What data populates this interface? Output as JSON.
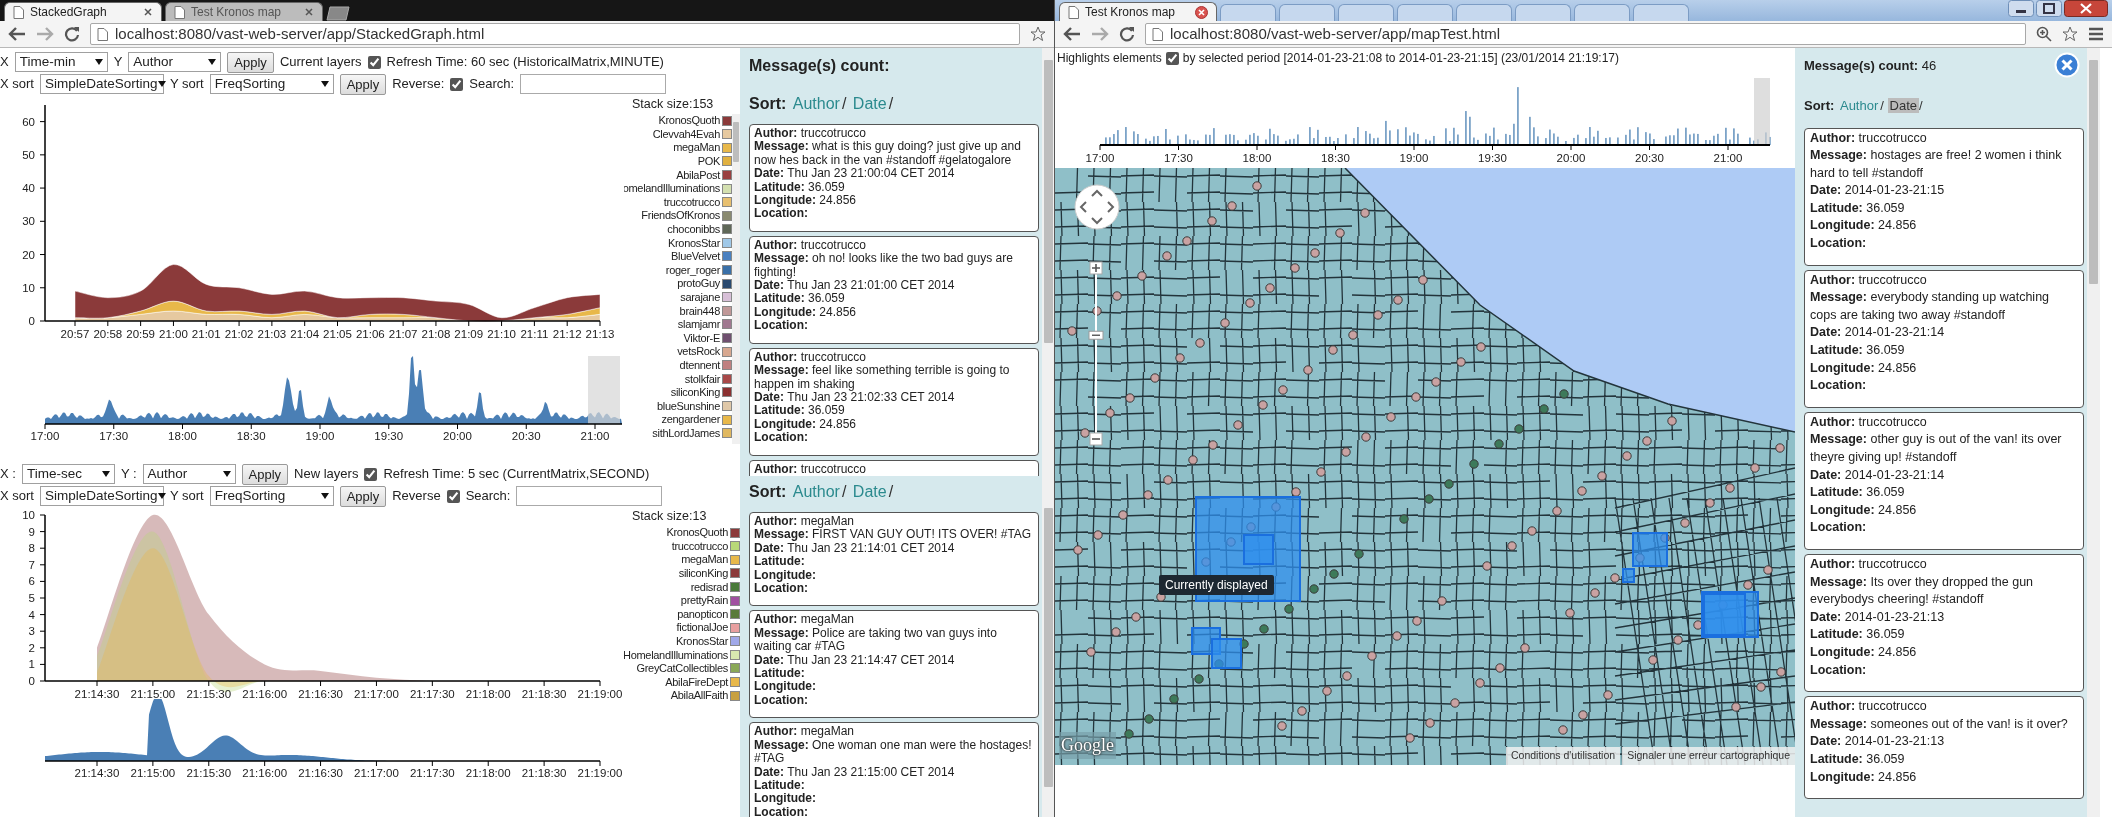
{
  "left_window": {
    "tabs": [
      {
        "title": "StackedGraph",
        "selected": true
      },
      {
        "title": "Test Kronos map",
        "selected": false
      }
    ],
    "address": "localhost:8080/vast-web-server/app/StackedGraph.html",
    "graphs": [
      {
        "controls": [
          [
            {
              "kind": "label",
              "text": "X"
            },
            {
              "kind": "select",
              "value": "Time-min"
            },
            {
              "kind": "label",
              "text": "Y"
            },
            {
              "kind": "select",
              "value": "Author"
            },
            {
              "kind": "button",
              "text": "Apply"
            },
            {
              "kind": "label",
              "text": "Current layers"
            },
            {
              "kind": "checkbox",
              "checked": true
            },
            {
              "kind": "label",
              "text": "Refresh Time: 60 sec (HistoricalMatrix,MINUTE)"
            }
          ],
          [
            {
              "kind": "label",
              "text": "X sort"
            },
            {
              "kind": "select",
              "value": "SimpleDateSorting"
            },
            {
              "kind": "label",
              "text": "Y sort"
            },
            {
              "kind": "select",
              "value": "FreqSorting"
            },
            {
              "kind": "button",
              "text": "Apply"
            },
            {
              "kind": "label",
              "text": "Reverse:"
            },
            {
              "kind": "checkbox",
              "checked": true
            },
            {
              "kind": "label",
              "text": "Search:"
            },
            {
              "kind": "input"
            }
          ]
        ],
        "stack_size": "Stack size:153",
        "legend": [
          {
            "name": "KronosQuoth",
            "color": "#8b3a3a"
          },
          {
            "name": "Clevvah4Evah",
            "color": "#e6c9a0"
          },
          {
            "name": "megaMan",
            "color": "#e8b84a"
          },
          {
            "name": "POK",
            "color": "#e0b040"
          },
          {
            "name": "AbilaPost",
            "color": "#9a4040"
          },
          {
            "name": "omelandIlluminations",
            "color": "#d4e0b0"
          },
          {
            "name": "truccotrucco",
            "color": "#e8c070"
          },
          {
            "name": "FriendsOfKronos",
            "color": "#8a8a70"
          },
          {
            "name": "choconibbs",
            "color": "#606858"
          },
          {
            "name": "KronosStar",
            "color": "#a0c8e8"
          },
          {
            "name": "BlueVelvet",
            "color": "#4a80c0"
          },
          {
            "name": "roger_roger",
            "color": "#3a70a8"
          },
          {
            "name": "protoGuy",
            "color": "#2a4a70"
          },
          {
            "name": "sarajane",
            "color": "#d8c0d8"
          },
          {
            "name": "brain448",
            "color": "#c09898"
          },
          {
            "name": "slamjamr",
            "color": "#a07890"
          },
          {
            "name": "Viktor-E",
            "color": "#705070"
          },
          {
            "name": "vetsRock",
            "color": "#d8a890"
          },
          {
            "name": "dtennent",
            "color": "#c08080"
          },
          {
            "name": "stolkfair",
            "color": "#a84848"
          },
          {
            "name": "siliconKing",
            "color": "#8b3030"
          },
          {
            "name": "blueSunshine",
            "color": "#e0c8a8"
          },
          {
            "name": "zengardener",
            "color": "#e8b84a"
          },
          {
            "name": "sithLordJames",
            "color": "#e0b860"
          }
        ],
        "chart_data": {
          "type": "area",
          "stacked": true,
          "ylim": [
            0,
            65
          ],
          "yticks": [
            0,
            10,
            20,
            30,
            40,
            50,
            60
          ],
          "categories": [
            "20:57",
            "20:58",
            "20:59",
            "21:00",
            "21:01",
            "21:02",
            "21:03",
            "21:04",
            "21:05",
            "21:06",
            "21:07",
            "21:08",
            "21:09",
            "21:10",
            "21:11",
            "21:12",
            "21:13"
          ],
          "series": [
            {
              "color": "#e6c9a0",
              "values": [
                1,
                1,
                2,
                3,
                2,
                2,
                1,
                2,
                1,
                1,
                1,
                1,
                0,
                0,
                1,
                1,
                2
              ]
            },
            {
              "color": "#e8b84a",
              "values": [
                0,
                0,
                1,
                3,
                1,
                1,
                1,
                1,
                0,
                1,
                1,
                0,
                0,
                0,
                0,
                1,
                2
              ]
            },
            {
              "color": "#8b3a3a",
              "values": [
                8,
                6,
                6,
                11,
                8,
                7,
                6,
                6,
                6,
                5,
                5,
                5,
                5,
                1,
                3,
                5,
                4
              ]
            }
          ]
        },
        "overview": {
          "ticks": [
            "17:00",
            "17:30",
            "18:00",
            "18:30",
            "19:00",
            "19:30",
            "20:00",
            "20:30",
            "21:00"
          ],
          "brush": true
        }
      },
      {
        "controls": [
          [
            {
              "kind": "label",
              "text": "X :"
            },
            {
              "kind": "select",
              "value": "Time-sec"
            },
            {
              "kind": "label",
              "text": "Y :"
            },
            {
              "kind": "select",
              "value": "Author"
            },
            {
              "kind": "button",
              "text": "Apply"
            },
            {
              "kind": "label",
              "text": "New layers"
            },
            {
              "kind": "checkbox",
              "checked": true
            },
            {
              "kind": "label",
              "text": "Refresh Time: 5 sec (CurrentMatrix,SECOND)"
            }
          ],
          [
            {
              "kind": "label",
              "text": "X sort"
            },
            {
              "kind": "select",
              "value": "SimpleDateSorting"
            },
            {
              "kind": "label",
              "text": "Y sort"
            },
            {
              "kind": "select",
              "value": "FreqSorting"
            },
            {
              "kind": "button",
              "text": "Apply"
            },
            {
              "kind": "label",
              "text": "Reverse"
            },
            {
              "kind": "checkbox",
              "checked": true
            },
            {
              "kind": "label",
              "text": "Search:"
            },
            {
              "kind": "input"
            }
          ]
        ],
        "stack_size": "Stack size:13",
        "legend": [
          {
            "name": "KronosQuoth",
            "color": "#8b3a3a"
          },
          {
            "name": "truccotrucco",
            "color": "#b8d878"
          },
          {
            "name": "megaMan",
            "color": "#e8b84a"
          },
          {
            "name": "siliconKing",
            "color": "#8b3a3a"
          },
          {
            "name": "redisrad",
            "color": "#4a7a3a"
          },
          {
            "name": "prettyRain",
            "color": "#a050a0"
          },
          {
            "name": "panopticon",
            "color": "#5a7a3a"
          },
          {
            "name": "fictionalJoe",
            "color": "#e8a0a0"
          },
          {
            "name": "KronosStar",
            "color": "#a0a8e8"
          },
          {
            "name": "HomelandIlluminations",
            "color": "#d8e8b0"
          },
          {
            "name": "GreyCatCollectibles",
            "color": "#8aa858"
          },
          {
            "name": "AbilaFireDept",
            "color": "#e8b84a"
          },
          {
            "name": "AbilaAllFaith",
            "color": "#c8a040"
          }
        ],
        "chart_data": {
          "type": "area",
          "stacked": false,
          "ylim": [
            0,
            10
          ],
          "yticks": [
            0,
            1,
            2,
            3,
            4,
            5,
            6,
            7,
            8,
            9,
            10
          ],
          "categories": [
            "21:14:30",
            "21:15:00",
            "21:15:30",
            "21:16:00",
            "21:16:30",
            "21:17:00",
            "21:17:30",
            "21:18:00",
            "21:18:30",
            "21:19:00"
          ],
          "series": [
            {
              "color": "#8b3a3a",
              "values": [
                2,
                10,
                4,
                1,
                0.6,
                0.2,
                0,
                0,
                0,
                0
              ]
            },
            {
              "color": "#b8d878",
              "values": [
                1.5,
                9,
                0,
                0,
                0,
                0,
                0,
                0,
                0,
                0
              ]
            },
            {
              "color": "#e8b84a",
              "values": [
                0.5,
                8,
                0.3,
                0,
                0,
                0,
                0,
                0,
                0,
                0
              ]
            }
          ]
        },
        "overview": {
          "ticks": [
            "21:14:30",
            "21:15:00",
            "21:15:30",
            "21:16:00",
            "21:16:30",
            "21:17:00",
            "21:17:30",
            "21:18:00",
            "21:18:30",
            "21:19:00"
          ]
        }
      }
    ],
    "messages_panel": {
      "sections": [
        {
          "count": {
            "label": "Message(s) count:"
          },
          "sort": {
            "label": "Sort:",
            "options": [
              {
                "label": "Author",
                "separator": "/",
                "selected": false
              },
              {
                "label": "Date",
                "separator": "/",
                "selected": false
              }
            ]
          },
          "messages": [
            {
              "fields": [
                {
                  "label": "Author:",
                  "value": "truccotrucco"
                },
                {
                  "label": "Message:",
                  "value": "what is this guy doing? just give up and now hes back in the van #standoff #gelatogalore"
                },
                {
                  "label": "Date:",
                  "value": "Thu Jan 23 21:00:04 CET 2014"
                },
                {
                  "label": "Latitude:",
                  "value": "36.059"
                },
                {
                  "label": "Longitude:",
                  "value": "24.856"
                },
                {
                  "label": "Location:"
                }
              ]
            },
            {
              "fields": [
                {
                  "label": "Author:",
                  "value": "truccotrucco"
                },
                {
                  "label": "Message:",
                  "value": "oh no! looks like the two bad guys are fighting!"
                },
                {
                  "label": "Date:",
                  "value": "Thu Jan 23 21:01:00 CET 2014"
                },
                {
                  "label": "Latitude:",
                  "value": "36.059"
                },
                {
                  "label": "Longitude:",
                  "value": "24.856"
                },
                {
                  "label": "Location:"
                }
              ]
            },
            {
              "fields": [
                {
                  "label": "Author:",
                  "value": "truccotrucco"
                },
                {
                  "label": "Message:",
                  "value": "feel like something terrible is going to happen im shaking"
                },
                {
                  "label": "Date:",
                  "value": "Thu Jan 23 21:02:33 CET 2014"
                },
                {
                  "label": "Latitude:",
                  "value": "36.059"
                },
                {
                  "label": "Longitude:",
                  "value": "24.856"
                },
                {
                  "label": "Location:"
                }
              ]
            },
            {
              "fields": [
                {
                  "label": "Author:",
                  "value": "truccotrucco"
                }
              ]
            }
          ]
        },
        {
          "sort": {
            "label": "Sort:",
            "options": [
              {
                "label": "Author",
                "separator": "/",
                "selected": false
              },
              {
                "label": "Date",
                "separator": "/",
                "selected": false
              }
            ]
          },
          "messages": [
            {
              "fields": [
                {
                  "label": "Author:",
                  "value": "megaMan"
                },
                {
                  "label": "Message:",
                  "value": "FIRST VAN GUY OUT! ITS OVER! #TAG"
                },
                {
                  "label": "Date:",
                  "value": "Thu Jan 23 21:14:01 CET 2014"
                },
                {
                  "label": "Latitude:"
                },
                {
                  "label": "Longitude:"
                },
                {
                  "label": "Location:"
                }
              ]
            },
            {
              "fields": [
                {
                  "label": "Author:",
                  "value": "megaMan"
                },
                {
                  "label": "Message:",
                  "value": "Police are taking two van guys into waiting car #TAG"
                },
                {
                  "label": "Date:",
                  "value": "Thu Jan 23 21:14:47 CET 2014"
                },
                {
                  "label": "Latitude:"
                },
                {
                  "label": "Longitude:"
                },
                {
                  "label": "Location:"
                }
              ]
            },
            {
              "fields": [
                {
                  "label": "Author:",
                  "value": "megaMan"
                },
                {
                  "label": "Message:",
                  "value": "One woman one man were the hostages! #TAG"
                },
                {
                  "label": "Date:",
                  "value": "Thu Jan 23 21:15:00 CET 2014"
                },
                {
                  "label": "Latitude:"
                },
                {
                  "label": "Longitude:"
                },
                {
                  "label": "Location:"
                }
              ]
            }
          ]
        }
      ]
    }
  },
  "right_window": {
    "tabs": [
      {
        "title": "Test Kronos map",
        "selected": true
      }
    ],
    "address": "localhost:8080/vast-web-server/app/mapTest.html",
    "highlight": {
      "label": "Highlights elements",
      "checked": true,
      "period": "by selected period [2014-01-23-21:08 to 2014-01-23-21:15] (23/01/2014 21:19:17)"
    },
    "histogram": {
      "ticks": [
        "17:00",
        "17:30",
        "18:00",
        "18:30",
        "19:00",
        "19:30",
        "20:00",
        "20:30",
        "21:00"
      ],
      "brush": true
    },
    "map": {
      "zoom": {
        "level": 0.64
      },
      "tooltip": "Currently displayed",
      "logo": "Google",
      "attribution": [
        "Conditions d'utilisation",
        "Signaler une erreur cartographique"
      ]
    },
    "messages_panel": {
      "closable": true,
      "sections": [
        {
          "count": {
            "label": "Message(s) count:",
            "value": "46"
          },
          "sort": {
            "label": "Sort:",
            "options": [
              {
                "label": "Author",
                "separator": "/",
                "selected": false
              },
              {
                "label": "Date",
                "separator": "/",
                "selected": true
              }
            ]
          },
          "messages": [
            {
              "fields": [
                {
                  "label": "Author:",
                  "value": "truccotrucco"
                },
                {
                  "label": "Message:",
                  "value": "hostages are free! 2 women i think hard to tell #standoff"
                },
                {
                  "label": "Date:",
                  "value": "2014-01-23-21:15"
                },
                {
                  "label": "Latitude:",
                  "value": "36.059"
                },
                {
                  "label": "Longitude:",
                  "value": "24.856"
                },
                {
                  "label": "Location:"
                }
              ]
            },
            {
              "fields": [
                {
                  "label": "Author:",
                  "value": "truccotrucco"
                },
                {
                  "label": "Message:",
                  "value": "everybody standing up watching cops are taking two away #standoff"
                },
                {
                  "label": "Date:",
                  "value": "2014-01-23-21:14"
                },
                {
                  "label": "Latitude:",
                  "value": "36.059"
                },
                {
                  "label": "Longitude:",
                  "value": "24.856"
                },
                {
                  "label": "Location:"
                }
              ]
            },
            {
              "fields": [
                {
                  "label": "Author:",
                  "value": "truccotrucco"
                },
                {
                  "label": "Message:",
                  "value": "other guy is out of the van! its over theyre giving up! #standoff"
                },
                {
                  "label": "Date:",
                  "value": "2014-01-23-21:14"
                },
                {
                  "label": "Latitude:",
                  "value": "36.059"
                },
                {
                  "label": "Longitude:",
                  "value": "24.856"
                },
                {
                  "label": "Location:"
                }
              ]
            },
            {
              "fields": [
                {
                  "label": "Author:",
                  "value": "truccotrucco"
                },
                {
                  "label": "Message:",
                  "value": "Its over they dropped the gun everybodys cheering! #standoff"
                },
                {
                  "label": "Date:",
                  "value": "2014-01-23-21:13"
                },
                {
                  "label": "Latitude:",
                  "value": "36.059"
                },
                {
                  "label": "Longitude:",
                  "value": "24.856"
                },
                {
                  "label": "Location:"
                }
              ]
            },
            {
              "fields": [
                {
                  "label": "Author:",
                  "value": "truccotrucco"
                },
                {
                  "label": "Message:",
                  "value": "someones out of the van! is it over?"
                },
                {
                  "label": "Date:",
                  "value": "2014-01-23-21:13"
                },
                {
                  "label": "Latitude:",
                  "value": "36.059"
                },
                {
                  "label": "Longitude:",
                  "value": "24.856"
                }
              ]
            }
          ]
        }
      ]
    }
  }
}
